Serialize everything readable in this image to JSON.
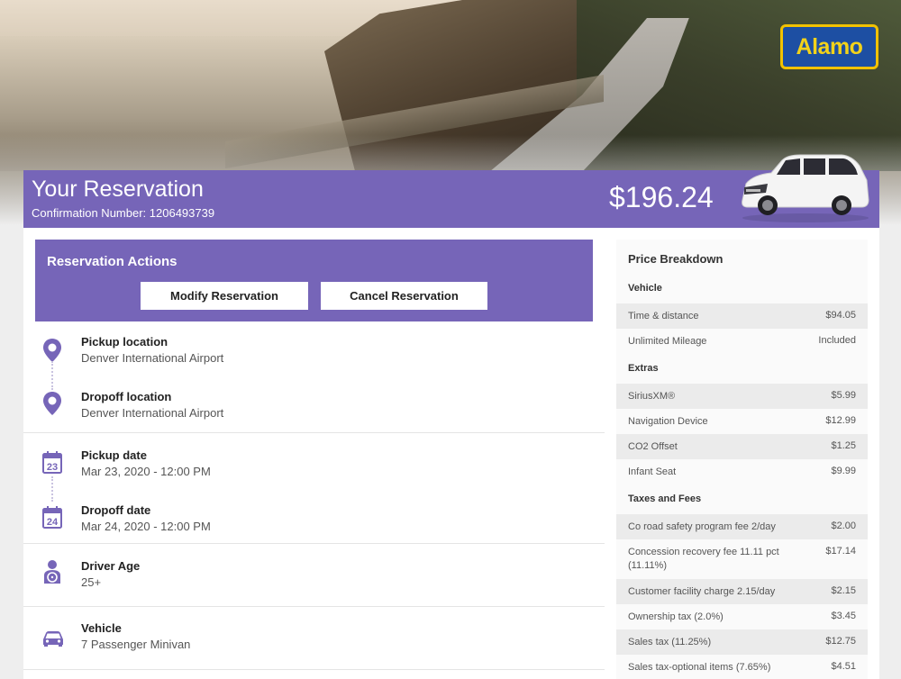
{
  "brand": {
    "logo_text": "Alamo"
  },
  "header": {
    "title": "Your Reservation",
    "confirmation": "Confirmation Number: 1206493739",
    "total": "$196.24"
  },
  "actions": {
    "heading": "Reservation Actions",
    "modify_label": "Modify Reservation",
    "cancel_label": "Cancel Reservation"
  },
  "details": {
    "pickup_location": {
      "label": "Pickup location",
      "value": "Denver International Airport"
    },
    "dropoff_location": {
      "label": "Dropoff location",
      "value": "Denver International Airport"
    },
    "pickup_date": {
      "label": "Pickup date",
      "value": "Mar 23, 2020 - 12:00 PM",
      "day": "23"
    },
    "dropoff_date": {
      "label": "Dropoff date",
      "value": "Mar 24, 2020 - 12:00 PM",
      "day": "24"
    },
    "driver_age": {
      "label": "Driver Age",
      "value": "25+"
    },
    "vehicle": {
      "label": "Vehicle",
      "value": "7 Passenger Minivan"
    }
  },
  "price": {
    "heading": "Price Breakdown",
    "sections": {
      "vehicle": "Vehicle",
      "extras": "Extras",
      "taxes": "Taxes and Fees"
    },
    "vehicle_items": [
      {
        "name": "Time & distance",
        "amount": "$94.05"
      },
      {
        "name": "Unlimited Mileage",
        "amount": "Included"
      }
    ],
    "extras_items": [
      {
        "name": "SiriusXM®",
        "amount": "$5.99"
      },
      {
        "name": "Navigation Device",
        "amount": "$12.99"
      },
      {
        "name": "CO2 Offset",
        "amount": "$1.25"
      },
      {
        "name": "Infant Seat",
        "amount": "$9.99"
      }
    ],
    "tax_items": [
      {
        "name": "Co road safety program fee 2/day",
        "amount": "$2.00"
      },
      {
        "name": "Concession recovery fee 11.11 pct (11.11%)",
        "amount": "$17.14"
      },
      {
        "name": "Customer facility charge 2.15/day",
        "amount": "$2.15"
      },
      {
        "name": "Ownership tax (2.0%)",
        "amount": "$3.45"
      },
      {
        "name": "Sales tax (11.25%)",
        "amount": "$12.75"
      },
      {
        "name": "Sales tax-optional items (7.65%)",
        "amount": "$4.51"
      }
    ]
  },
  "colors": {
    "accent": "#7665b8",
    "logo_blue": "#1d4fa3",
    "logo_yellow": "#f2d21a"
  }
}
